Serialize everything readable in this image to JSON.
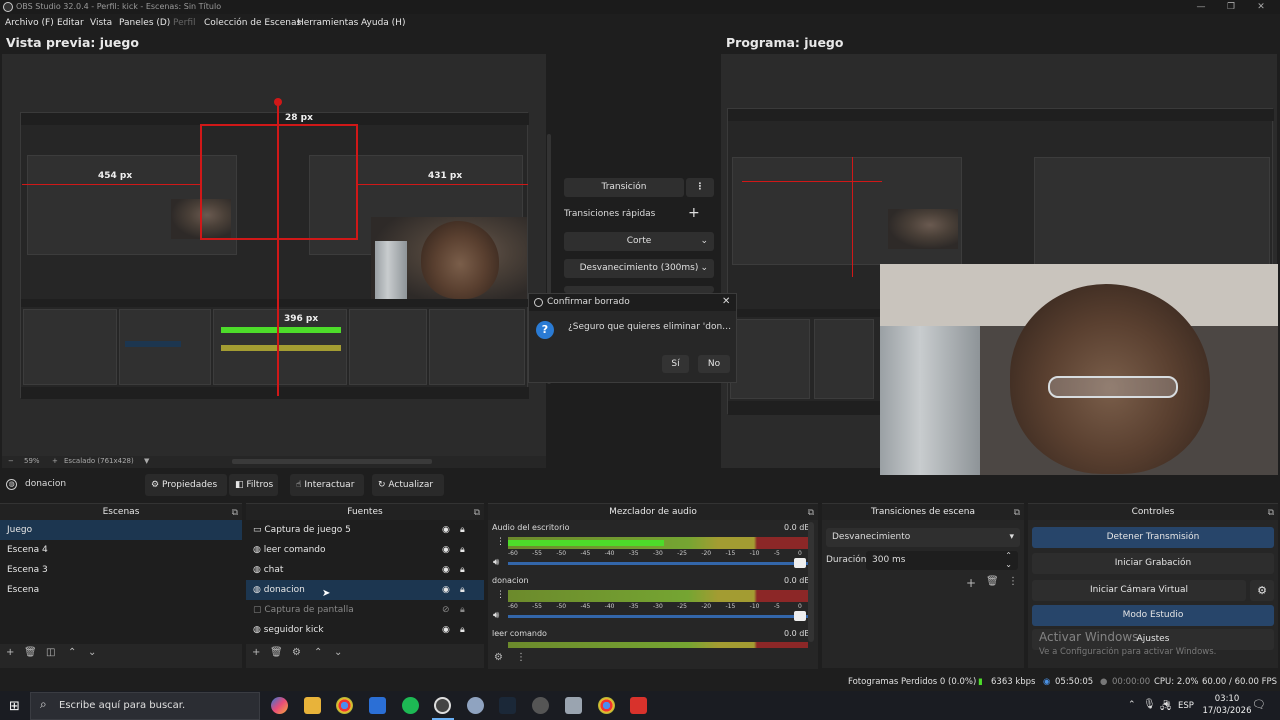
{
  "window": {
    "title": "OBS Studio 32.0.4 - Perfil: kick - Escenas: Sin Título",
    "controls": [
      "—",
      "❐",
      "✕"
    ]
  },
  "menu": [
    {
      "label": "Archivo (F)",
      "disabled": false
    },
    {
      "label": "Editar",
      "disabled": false
    },
    {
      "label": "Vista",
      "disabled": false
    },
    {
      "label": "Paneles (D)",
      "disabled": false
    },
    {
      "label": "Perfil",
      "disabled": true
    },
    {
      "label": "Colección de Escenas",
      "disabled": false
    },
    {
      "label": "Herramientas",
      "disabled": false
    },
    {
      "label": "Ayuda (H)",
      "disabled": false
    }
  ],
  "preview": {
    "title": "Vista previa: juego",
    "measurements": [
      "28 px",
      "454 px",
      "431 px",
      "396 px"
    ],
    "zoom": "59%",
    "scale_label": "Escalado (761x428)"
  },
  "program": {
    "title": "Programa: juego"
  },
  "transitions_center": {
    "transition_button": "Transición",
    "quick_label": "Transiciones rápidas",
    "items": [
      "Corte",
      "Desvanecimiento (300ms)"
    ]
  },
  "dialog": {
    "title": "Confirmar borrado",
    "message": "¿Seguro que quieres eliminar 'donacion'?",
    "yes": "Sí",
    "no": "No"
  },
  "source_toolbar": {
    "selected_source": "donacion",
    "properties": "Propiedades",
    "filters": "Filtros",
    "interact": "Interactuar",
    "refresh": "Actualizar"
  },
  "scenes": {
    "title": "Escenas",
    "items": [
      {
        "name": "Juego",
        "selected": true
      },
      {
        "name": "Escena 4",
        "selected": false
      },
      {
        "name": "Escena 3",
        "selected": false
      },
      {
        "name": "Escena",
        "selected": false
      }
    ]
  },
  "sources": {
    "title": "Fuentes",
    "items": [
      {
        "name": "Captura de juego 5",
        "icon": "gamepad-icon",
        "visible": true,
        "selected": false,
        "dim": false
      },
      {
        "name": "leer comando",
        "icon": "globe-icon",
        "visible": true,
        "selected": false,
        "dim": false
      },
      {
        "name": "chat",
        "icon": "globe-icon",
        "visible": true,
        "selected": false,
        "dim": false
      },
      {
        "name": "donacion",
        "icon": "globe-icon",
        "visible": true,
        "selected": true,
        "dim": false
      },
      {
        "name": "Captura de pantalla",
        "icon": "monitor-icon",
        "visible": false,
        "selected": false,
        "dim": true
      },
      {
        "name": "seguidor kick",
        "icon": "globe-icon",
        "visible": true,
        "selected": false,
        "dim": false
      }
    ]
  },
  "mixer": {
    "title": "Mezclador de audio",
    "ticks": [
      "-60",
      "-55",
      "-50",
      "-45",
      "-40",
      "-35",
      "-30",
      "-25",
      "-20",
      "-15",
      "-10",
      "-5",
      "0"
    ],
    "channels": [
      {
        "name": "Audio del escritorio",
        "db": "0.0 dB",
        "level": 0.52
      },
      {
        "name": "donacion",
        "db": "0.0 dB",
        "level": 0.0
      },
      {
        "name": "leer comando",
        "db": "0.0 dB",
        "level": 0.0
      }
    ]
  },
  "scene_transitions": {
    "title": "Transiciones de escena",
    "selected": "Desvanecimiento",
    "duration_label": "Duración",
    "duration_value": "300 ms"
  },
  "controls": {
    "title": "Controles",
    "buttons": [
      {
        "label": "Detener Transmisión",
        "active": true
      },
      {
        "label": "Iniciar Grabación",
        "active": false
      },
      {
        "label": "Iniciar Cámara Virtual",
        "active": false
      },
      {
        "label": "Modo Estudio",
        "active": true
      },
      {
        "label": "Ajustes",
        "active": false
      }
    ],
    "watermark_title": "Activar Windows",
    "watermark_sub": "Ve a Configuración para activar Windows."
  },
  "status": {
    "dropped": "Fotogramas Perdidos 0 (0.0%)",
    "bitrate": "6363 kbps",
    "stream_time": "05:50:05",
    "rec_time": "00:00:00",
    "cpu": "CPU: 2.0%",
    "fps": "60.00 / 60.00 FPS"
  },
  "taskbar": {
    "search_placeholder": "Escribe aquí para buscar.",
    "language": "ESP",
    "time": "03:10",
    "date": "17/03/2026"
  },
  "colors": {
    "accent_selected": "#1c3650",
    "button_active": "#27456a",
    "guide_red": "#d01818",
    "meter_green": "#4ddc2a"
  }
}
